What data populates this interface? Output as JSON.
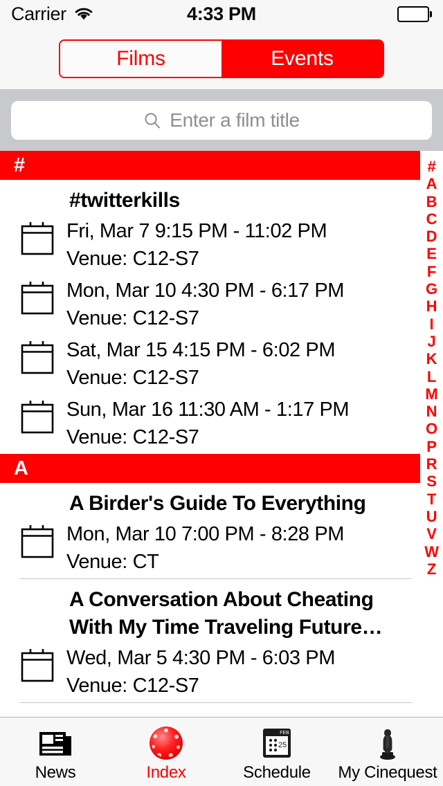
{
  "status_bar": {
    "carrier": "Carrier",
    "wifi_icon": "wifi-icon",
    "time": "4:33 PM",
    "battery_icon": "battery-full-icon"
  },
  "segmented_control": {
    "segments": [
      {
        "label": "Films",
        "selected": false
      },
      {
        "label": "Events",
        "selected": true
      }
    ],
    "accent_color": "#ff0000"
  },
  "search": {
    "icon": "search-icon",
    "placeholder": "Enter a film title",
    "value": ""
  },
  "sections": [
    {
      "letter": "#",
      "films": [
        {
          "title": "#twitterkills",
          "events": [
            {
              "icon": "calendar-icon",
              "datetime": "Fri, Mar 7 9:15 PM - 11:02 PM",
              "venue": "Venue: C12-S7"
            },
            {
              "icon": "calendar-icon",
              "datetime": "Mon, Mar 10 4:30 PM - 6:17 PM",
              "venue": "Venue: C12-S7"
            },
            {
              "icon": "calendar-icon",
              "datetime": "Sat, Mar 15 4:15 PM - 6:02 PM",
              "venue": "Venue: C12-S7"
            },
            {
              "icon": "calendar-icon",
              "datetime": "Sun, Mar 16 11:30 AM - 1:17 PM",
              "venue": "Venue: C12-S7"
            }
          ]
        }
      ]
    },
    {
      "letter": "A",
      "films": [
        {
          "title": "A Birder's Guide To Everything",
          "events": [
            {
              "icon": "calendar-icon",
              "datetime": "Mon, Mar 10 7:00 PM - 8:28 PM",
              "venue": "Venue: CT"
            }
          ]
        },
        {
          "title": "A Conversation About Cheating With My Time Traveling Future…",
          "events": [
            {
              "icon": "calendar-icon",
              "datetime": "Wed, Mar 5 4:30 PM - 6:03 PM",
              "venue": "Venue: C12-S7"
            }
          ]
        }
      ]
    }
  ],
  "index_bar": {
    "letters": [
      "#",
      "A",
      "B",
      "C",
      "D",
      "E",
      "F",
      "G",
      "H",
      "I",
      "J",
      "K",
      "L",
      "M",
      "N",
      "O",
      "P",
      "R",
      "S",
      "T",
      "U",
      "V",
      "W",
      "Z"
    ],
    "color": "#ff0000"
  },
  "tab_bar": {
    "tabs": [
      {
        "label": "News",
        "icon": "newspaper-icon",
        "selected": false
      },
      {
        "label": "Index",
        "icon": "red-sphere-icon",
        "selected": true
      },
      {
        "label": "Schedule",
        "icon": "calendar-schedule-icon",
        "selected": false
      },
      {
        "label": "My Cinequest",
        "icon": "oscar-statuette-icon",
        "selected": false
      }
    ],
    "schedule_icon_text": {
      "month": "FEB",
      "day": "25"
    },
    "selected_color": "#ff0000"
  }
}
